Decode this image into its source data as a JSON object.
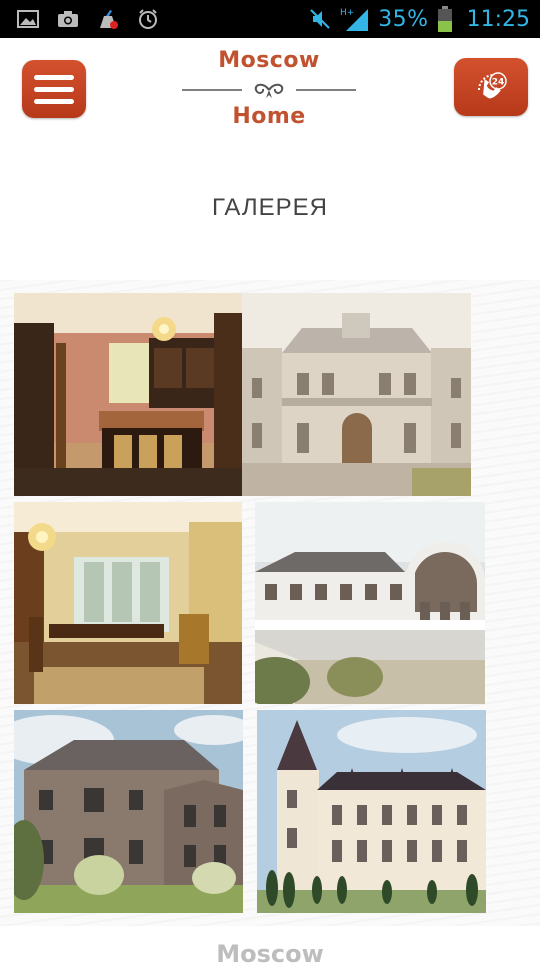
{
  "status_bar": {
    "battery_percent": "35%",
    "time": "11:25",
    "network_type": "H+",
    "icons": [
      "image-icon",
      "camera-icon",
      "cleaner-icon",
      "alarm-clock-icon",
      "mute-icon",
      "signal-icon",
      "battery-icon"
    ]
  },
  "header": {
    "logo_line1": "Moscow",
    "logo_line2": "Home",
    "menu_icon": "hamburger-icon",
    "call_icon": "phone-24-icon",
    "call_badge": "24",
    "accent_color": "#c1522f"
  },
  "page": {
    "title": "ГАЛЕРЕЯ"
  },
  "gallery": {
    "items": [
      {
        "subject": "kitchen"
      },
      {
        "subject": "palace-facade"
      },
      {
        "subject": "dining-room"
      },
      {
        "subject": "white-mansion"
      },
      {
        "subject": "brick-house"
      },
      {
        "subject": "chateau"
      }
    ]
  },
  "footer": {
    "logo_text": "Moscow"
  }
}
